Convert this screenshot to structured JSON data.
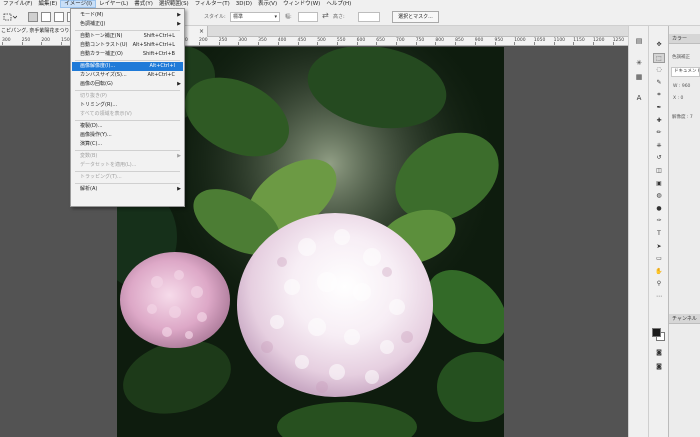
{
  "menubar": {
    "items": [
      {
        "label": "ファイル(F)"
      },
      {
        "label": "編集(E)"
      },
      {
        "label": "イメージ(I)"
      },
      {
        "label": "レイヤー(L)"
      },
      {
        "label": "書式(Y)"
      },
      {
        "label": "選択範囲(S)"
      },
      {
        "label": "フィルター(T)"
      },
      {
        "label": "3D(D)"
      },
      {
        "label": "表示(V)"
      },
      {
        "label": "ウィンドウ(W)"
      },
      {
        "label": "ヘルプ(H)"
      }
    ]
  },
  "options": {
    "style_label": "スタイル:",
    "style_value": "標準",
    "width_label": "幅:",
    "height_label": "高さ:",
    "select_mask_button": "選択とマスク..."
  },
  "document": {
    "tab_title": "こピパング, 奈手紫陽花まつり... @ 16.7% (RGB/8)*",
    "close_glyph": "×",
    "ruler_ticks": [
      "300",
      "250",
      "200",
      "150",
      "100",
      "50",
      "0",
      "50",
      "100",
      "150",
      "200",
      "250",
      "300",
      "350",
      "400",
      "450",
      "500",
      "550",
      "600",
      "650",
      "700",
      "750",
      "800",
      "850",
      "900",
      "950",
      "1000",
      "1050",
      "1100",
      "1150",
      "1200",
      "1250"
    ]
  },
  "image_menu": {
    "items": [
      {
        "label": "モード(M)",
        "shortcut": "",
        "submenu": true,
        "state": "normal"
      },
      {
        "label": "色調補正(J)",
        "shortcut": "",
        "submenu": true,
        "state": "normal"
      },
      {
        "label": "自動トーン補正(N)",
        "shortcut": "Shift+Ctrl+L",
        "submenu": false,
        "state": "normal"
      },
      {
        "label": "自動コントラスト(U)",
        "shortcut": "Alt+Shift+Ctrl+L",
        "submenu": false,
        "state": "normal"
      },
      {
        "label": "自動カラー補正(O)",
        "shortcut": "Shift+Ctrl+B",
        "submenu": false,
        "state": "normal"
      },
      {
        "label": "画像解像度(I)...",
        "shortcut": "Alt+Ctrl+I",
        "submenu": false,
        "state": "highlighted"
      },
      {
        "label": "カンバスサイズ(S)...",
        "shortcut": "Alt+Ctrl+C",
        "submenu": false,
        "state": "normal"
      },
      {
        "label": "画像の回転(G)",
        "shortcut": "",
        "submenu": true,
        "state": "normal"
      },
      {
        "label": "切り抜き(P)",
        "shortcut": "",
        "submenu": false,
        "state": "disabled"
      },
      {
        "label": "トリミング(R)...",
        "shortcut": "",
        "submenu": false,
        "state": "normal"
      },
      {
        "label": "すべての領域を表示(V)",
        "shortcut": "",
        "submenu": false,
        "state": "disabled"
      },
      {
        "label": "複製(D)...",
        "shortcut": "",
        "submenu": false,
        "state": "normal"
      },
      {
        "label": "画像操作(Y)...",
        "shortcut": "",
        "submenu": false,
        "state": "normal"
      },
      {
        "label": "演算(C)...",
        "shortcut": "",
        "submenu": false,
        "state": "normal"
      },
      {
        "label": "変数(B)",
        "shortcut": "",
        "submenu": true,
        "state": "disabled"
      },
      {
        "label": "データセットを適用(L)...",
        "shortcut": "",
        "submenu": false,
        "state": "disabled"
      },
      {
        "label": "トラッピング(T)...",
        "shortcut": "",
        "submenu": false,
        "state": "disabled"
      },
      {
        "label": "解析(A)",
        "shortcut": "",
        "submenu": true,
        "state": "normal"
      }
    ],
    "submenu_arrow": "▶"
  },
  "panels": {
    "top_tab": "カラー",
    "properties_tab": "プロパティ",
    "tone_label": "色調補正",
    "doc_label": "ドキュメント",
    "width_text": "W : 960",
    "x_text": "X : 0",
    "resolution_text": "解像度 : 7",
    "layers_tab": "レイヤー",
    "channels_tab": "チャンネル"
  },
  "colors": {
    "accent": "#1f7ad8",
    "canvas_bg": "#535353",
    "chrome": "#f0f0f0"
  },
  "tools": [
    "move-tool",
    "marquee-tool",
    "lasso-tool",
    "quick-select-tool",
    "crop-tool",
    "eyedropper-tool",
    "healing-tool",
    "brush-tool",
    "stamp-tool",
    "history-brush-tool",
    "eraser-tool",
    "gradient-tool",
    "blur-tool",
    "dodge-tool",
    "pen-tool",
    "type-tool",
    "path-select-tool",
    "rectangle-tool",
    "hand-tool",
    "zoom-tool",
    "more-tools"
  ]
}
